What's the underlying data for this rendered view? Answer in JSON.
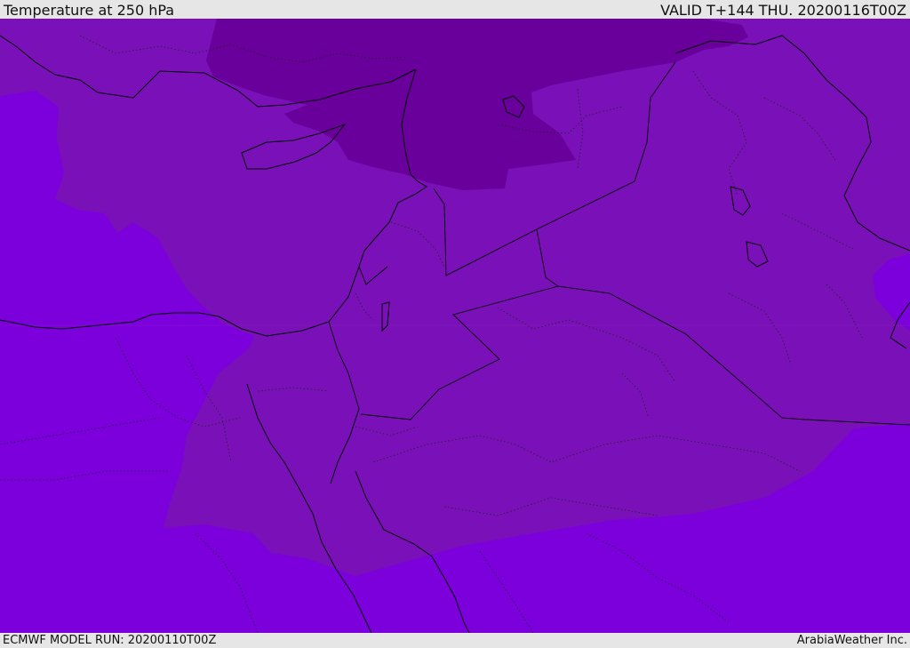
{
  "header": {
    "title": "Temperature at 250 hPa",
    "valid": "VALID T+144 THU. 20200116T00Z"
  },
  "footer": {
    "model_run": "ECMWF MODEL RUN: 20200110T00Z",
    "credit": "ArabiaWeather Inc."
  },
  "colors": {
    "outer_band": "#7c00dc",
    "middle_band": "#7a10b8",
    "inner_band": "#69009c",
    "coastline": "#000000",
    "border": "#000000"
  }
}
